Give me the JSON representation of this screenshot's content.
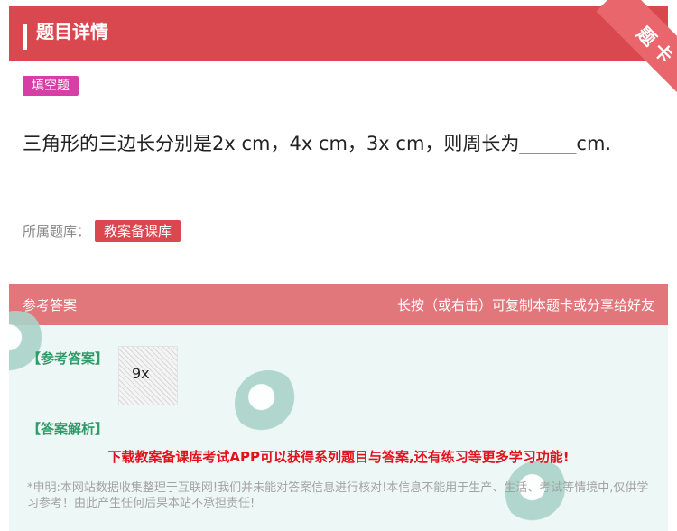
{
  "header": {
    "title": "题目详情",
    "corner_label": "题卡"
  },
  "question": {
    "type_tag": "填空题",
    "text": "三角形的三边长分别是2x cm，4x cm，3x cm，则周长为______cm.",
    "bank_label": "所属题库：",
    "bank_name": "教案备课库"
  },
  "answer": {
    "header_left": "参考答案",
    "header_right": "长按（或右击）可复制本题卡或分享给好友",
    "ref_label": "【参考答案】",
    "answer_text": "9x",
    "analysis_label": "【答案解析】",
    "promo": "下载教案备课库考试APP可以获得系列题目与答案,还有练习等更多学习功能!",
    "disclaimer": "*申明:本网站数据收集整理于互联网!我们并未能对答案信息进行核对!本信息不能用于生产、生活、考试等情境中,仅供学习参考！由此产生任何后果本站不承担责任!"
  },
  "colors": {
    "header_bg": "#d9474f",
    "answer_head_bg": "#e1767b",
    "type_tag_bg": "#d63fa6",
    "accent_green": "#2e9c6a",
    "promo_red": "#e3101e"
  }
}
